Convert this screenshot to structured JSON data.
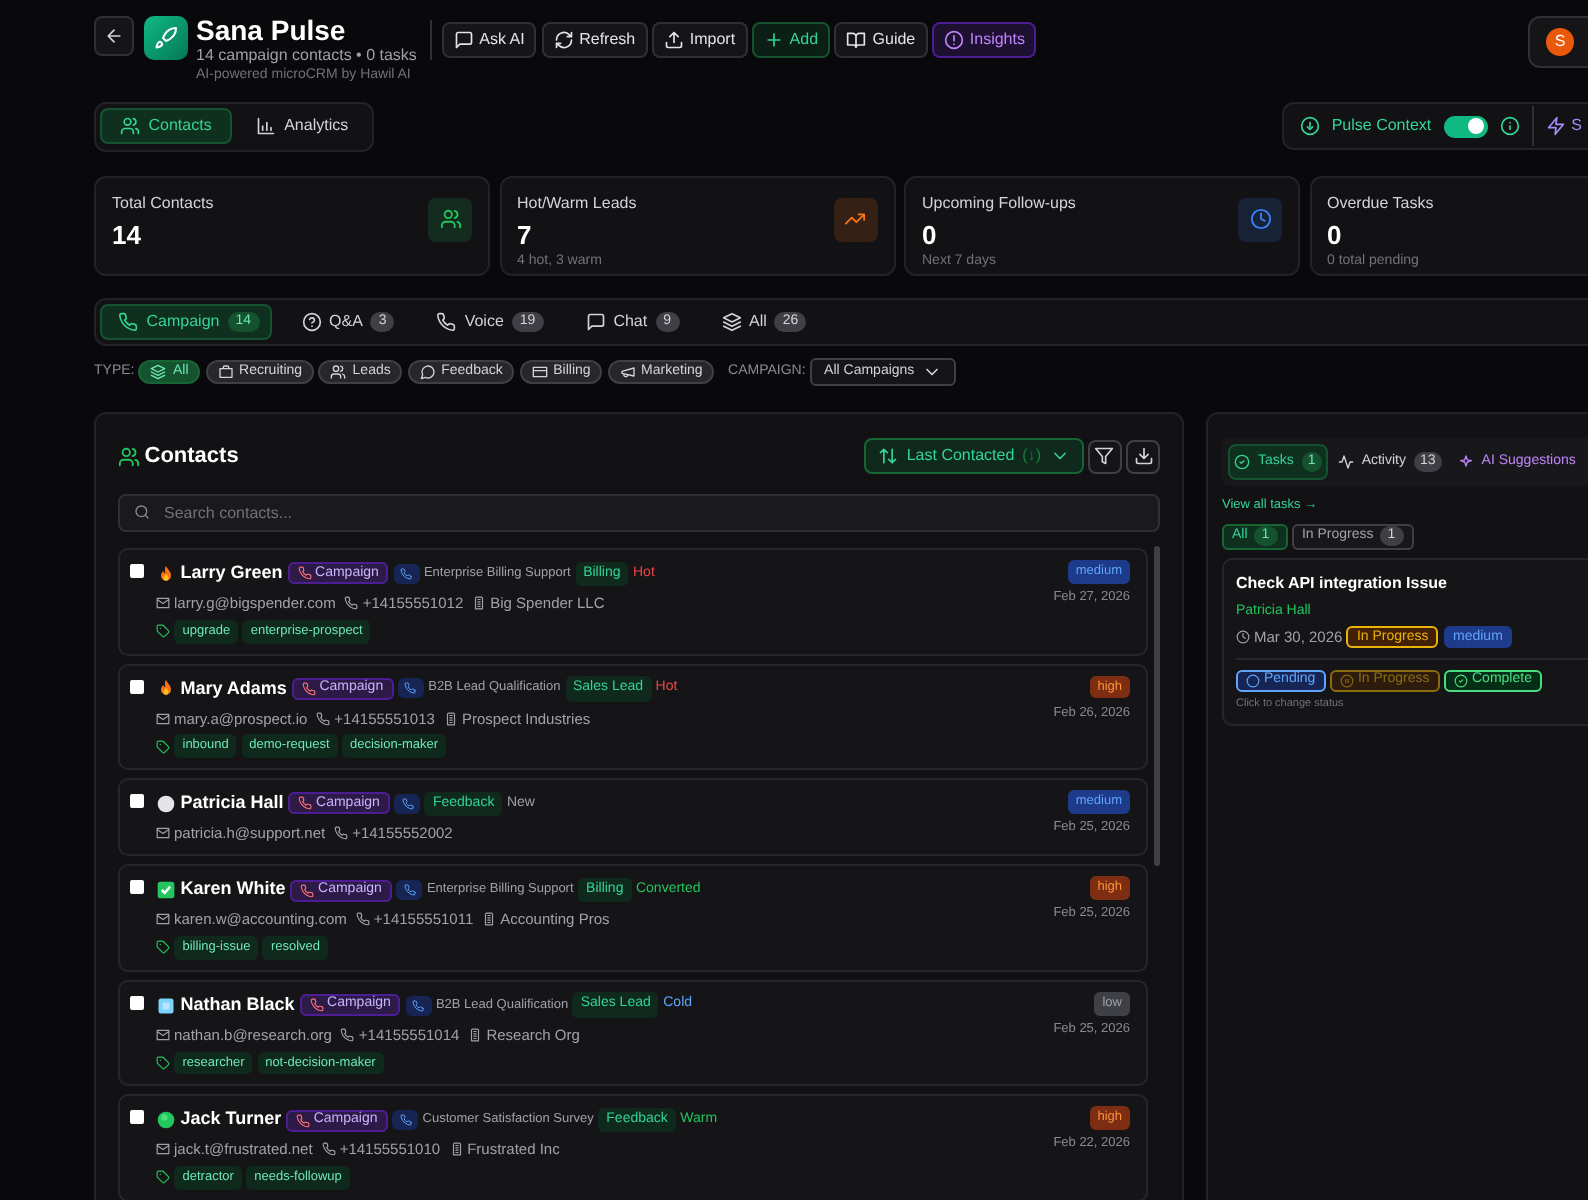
{
  "header": {
    "title": "Sana Pulse",
    "subtitle": "14 campaign contacts • 0 tasks",
    "tagline": "AI-powered microCRM by Hawil AI",
    "avatar": "S",
    "buttons": [
      {
        "label": "Ask AI",
        "kind": "ask"
      },
      {
        "label": "Refresh",
        "kind": "refresh"
      },
      {
        "label": "Import",
        "kind": "import"
      },
      {
        "label": "Add",
        "kind": "add"
      },
      {
        "label": "Guide",
        "kind": "guide"
      },
      {
        "label": "Insights",
        "kind": "insights"
      }
    ]
  },
  "view_tabs": [
    {
      "label": "Contacts",
      "kind": "contacts",
      "selected": true
    },
    {
      "label": "Analytics",
      "kind": "analytics",
      "selected": false
    }
  ],
  "pulse_context": {
    "label": "Pulse Context",
    "on": true,
    "next_label": "S"
  },
  "stats": [
    {
      "label": "Total Contacts",
      "value": "14",
      "kind": "people",
      "color": "#22c55e"
    },
    {
      "label": "Hot/Warm Leads",
      "value": "7",
      "sub": "4 hot, 3 warm",
      "kind": "trend",
      "color": "#f97316"
    },
    {
      "label": "Upcoming Follow-ups",
      "value": "0",
      "sub": "Next 7 days",
      "kind": "clock",
      "color": "#3b82f6"
    },
    {
      "label": "Overdue Tasks",
      "value": "0",
      "sub": "0 total pending"
    }
  ],
  "channel_tabs": [
    {
      "label": "Campaign",
      "count": "14",
      "kind": "phone",
      "selected": true
    },
    {
      "label": "Q&A",
      "count": "3",
      "kind": "help",
      "selected": false
    },
    {
      "label": "Voice",
      "count": "19",
      "kind": "phone",
      "selected": false
    },
    {
      "label": "Chat",
      "count": "9",
      "kind": "chat",
      "selected": false
    },
    {
      "label": "All",
      "count": "26",
      "kind": "layers",
      "selected": false
    }
  ],
  "type_filter": {
    "label": "TYPE:",
    "options": [
      {
        "label": "All",
        "kind": "layers",
        "selected": true
      },
      {
        "label": "Recruiting",
        "kind": "briefcase",
        "selected": false
      },
      {
        "label": "Leads",
        "kind": "people",
        "selected": false
      },
      {
        "label": "Feedback",
        "kind": "bubble",
        "selected": false
      },
      {
        "label": "Billing",
        "kind": "card",
        "selected": false
      },
      {
        "label": "Marketing",
        "kind": "megaphone",
        "selected": false
      }
    ]
  },
  "campaign_filter": {
    "label": "CAMPAIGN:",
    "value": "All Campaigns"
  },
  "contacts": {
    "title": "Contacts",
    "sort": {
      "label": "Last Contacted",
      "direction": "(↓)"
    },
    "search_placeholder": "Search contacts...",
    "rows": [
      {
        "name": "Larry Green",
        "kind": "hot",
        "checked": false,
        "source": "Campaign",
        "campaign": "Enterprise Billing Support",
        "category": "Billing",
        "temperature": "Hot",
        "email": "larry.g@bigspender.com",
        "phone": "+14155551012",
        "company": "Big Spender LLC",
        "tags": [
          "upgrade",
          "enterprise-prospect"
        ],
        "priority": {
          "label": "medium",
          "kind": "medium"
        },
        "date": "Feb 27, 2026"
      },
      {
        "name": "Mary Adams",
        "kind": "hot",
        "checked": false,
        "source": "Campaign",
        "campaign": "B2B Lead Qualification",
        "category": "Sales Lead",
        "temperature": "Hot",
        "email": "mary.a@prospect.io",
        "phone": "+14155551013",
        "company": "Prospect Industries",
        "tags": [
          "inbound",
          "demo-request",
          "decision-maker"
        ],
        "priority": {
          "label": "high",
          "kind": "high"
        },
        "date": "Feb 26, 2026"
      },
      {
        "name": "Patricia Hall",
        "kind": "new",
        "checked": false,
        "source": "Campaign",
        "category": "Feedback",
        "temperature": "New",
        "email": "patricia.h@support.net",
        "phone": "+14155552002",
        "priority": {
          "label": "medium",
          "kind": "medium"
        },
        "date": "Feb 25, 2026"
      },
      {
        "name": "Karen White",
        "kind": "converted",
        "checked": false,
        "source": "Campaign",
        "campaign": "Enterprise Billing Support",
        "category": "Billing",
        "temperature": "Converted",
        "email": "karen.w@accounting.com",
        "phone": "+14155551011",
        "company": "Accounting Pros",
        "tags": [
          "billing-issue",
          "resolved"
        ],
        "priority": {
          "label": "high",
          "kind": "high"
        },
        "date": "Feb 25, 2026"
      },
      {
        "name": "Nathan Black",
        "kind": "cold",
        "checked": false,
        "source": "Campaign",
        "campaign": "B2B Lead Qualification",
        "category": "Sales Lead",
        "temperature": "Cold",
        "email": "nathan.b@research.org",
        "phone": "+14155551014",
        "company": "Research Org",
        "tags": [
          "researcher",
          "not-decision-maker"
        ],
        "priority": {
          "label": "low",
          "kind": "low"
        },
        "date": "Feb 25, 2026"
      },
      {
        "name": "Jack Turner",
        "kind": "warm",
        "checked": false,
        "source": "Campaign",
        "campaign": "Customer Satisfaction Survey",
        "category": "Feedback",
        "temperature": "Warm",
        "email": "jack.t@frustrated.net",
        "phone": "+14155551010",
        "company": "Frustrated Inc",
        "tags": [
          "detractor",
          "needs-followup"
        ],
        "priority": {
          "label": "high",
          "kind": "high"
        },
        "date": "Feb 22, 2026"
      }
    ]
  },
  "tasks_panel": {
    "tabs": [
      {
        "label": "Tasks",
        "count": "1",
        "kind": "tasks",
        "selected": true
      },
      {
        "label": "Activity",
        "count": "13",
        "kind": "activity",
        "selected": false
      },
      {
        "label": "AI Suggestions",
        "kind": "ai",
        "selected": false
      }
    ],
    "view_all": "View all tasks →",
    "filters": [
      {
        "label": "All",
        "count": "1",
        "selected": true
      },
      {
        "label": "In Progress",
        "count": "1",
        "selected": false
      }
    ],
    "tasks": [
      {
        "title": "Check API integration Issue",
        "assignee": "Patricia Hall",
        "due": "Mar 30, 2026",
        "status": {
          "label": "In Progress",
          "kind": "progress"
        },
        "priority": {
          "label": "medium",
          "kind": "medium"
        },
        "status_buttons": [
          {
            "label": "Pending",
            "kind": "pending",
            "selected": false
          },
          {
            "label": "In Progress",
            "kind": "progress",
            "selected": true
          },
          {
            "label": "Complete",
            "kind": "complete",
            "selected": false
          }
        ],
        "hint": "Click to change status"
      }
    ]
  }
}
